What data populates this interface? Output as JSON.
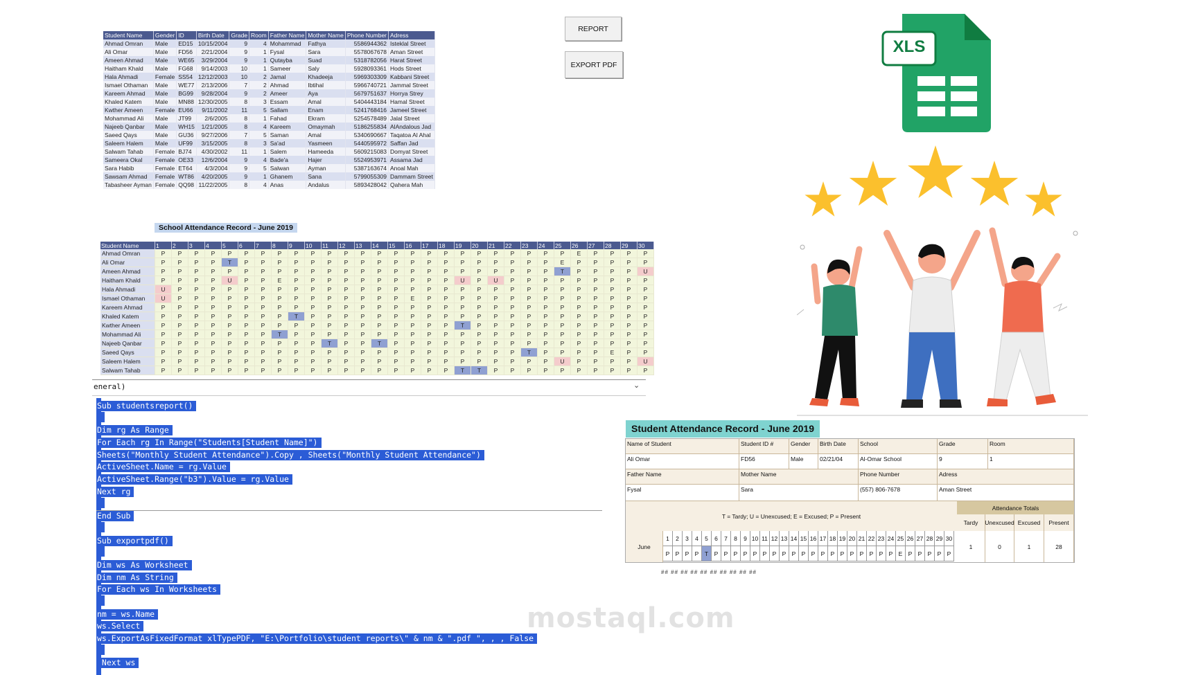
{
  "students": {
    "columns": [
      "Student Name",
      "Gender",
      "ID",
      "Birth Date",
      "Grade",
      "Room",
      "Father Name",
      "Mother Name",
      "Phone Number",
      "Adress"
    ],
    "rows": [
      [
        "Ahmad Omran",
        "Male",
        "ED15",
        "10/15/2004",
        "9",
        "4",
        "Mohammad",
        "Fathya",
        "5586944362",
        "Isteklal Street"
      ],
      [
        "Ali Omar",
        "Male",
        "FD56",
        "2/21/2004",
        "9",
        "1",
        "Fysal",
        "Sara",
        "5578067678",
        "Aman Street"
      ],
      [
        "Ameen Ahmad",
        "Male",
        "WE65",
        "3/29/2004",
        "9",
        "1",
        "Qutayba",
        "Suad",
        "5318782056",
        "Harat Street"
      ],
      [
        "Haitham Khald",
        "Male",
        "FG68",
        "9/14/2003",
        "10",
        "1",
        "Sameer",
        "Saly",
        "5928093361",
        "Hods Street"
      ],
      [
        "Hala Ahmadi",
        "Female",
        "SS54",
        "12/12/2003",
        "10",
        "2",
        "Jamal",
        "Khadeeja",
        "5969303309",
        "Kabbani Street"
      ],
      [
        "Ismael Othaman",
        "Male",
        "WE77",
        "2/13/2006",
        "7",
        "2",
        "Ahmad",
        "Ibtihal",
        "5966740721",
        "Jammal Street"
      ],
      [
        "Kareem Ahmad",
        "Male",
        "BG99",
        "9/28/2004",
        "9",
        "2",
        "Ameer",
        "Aya",
        "5679751637",
        "Horrya Strey"
      ],
      [
        "Khaled Katem",
        "Male",
        "MN88",
        "12/30/2005",
        "8",
        "3",
        "Essam",
        "Amal",
        "5404443184",
        "Hamal Street"
      ],
      [
        "Kwther Ameen",
        "Female",
        "EU66",
        "9/11/2002",
        "11",
        "5",
        "Sallam",
        "Enam",
        "5241768416",
        "Jameel Street"
      ],
      [
        "Mohammad Ali",
        "Male",
        "JT99",
        "2/6/2005",
        "8",
        "1",
        "Fahad",
        "Ekram",
        "5254578489",
        "Jalal Street"
      ],
      [
        "Najeeb Qanbar",
        "Male",
        "WH15",
        "1/21/2005",
        "8",
        "4",
        "Kareem",
        "Omaymah",
        "5186255834",
        "AlAndalous Jad"
      ],
      [
        "Saeed Qays",
        "Male",
        "GU36",
        "9/27/2006",
        "7",
        "5",
        "Saman",
        "Amal",
        "5340690667",
        "Taqatoa Al Ahal"
      ],
      [
        "Saleem Halem",
        "Male",
        "UF99",
        "3/15/2005",
        "8",
        "3",
        "Sa'ad",
        "Yasmeen",
        "5440595972",
        "Saffan Jad"
      ],
      [
        "Salwam Tahab",
        "Female",
        "BJ74",
        "4/30/2002",
        "11",
        "1",
        "Salem",
        "Hameeda",
        "5609215083",
        "Domyat Street"
      ],
      [
        "Sameera Okal",
        "Female",
        "OE33",
        "12/6/2004",
        "9",
        "4",
        "Bade'a",
        "Hajer",
        "5524953971",
        "Assama Jad"
      ],
      [
        "Sara Habib",
        "Female",
        "ET64",
        "4/3/2004",
        "9",
        "5",
        "Salwan",
        "Ayman",
        "5387163674",
        "Anoal Mah"
      ],
      [
        "Sawsam Ahmad",
        "Female",
        "WT86",
        "4/20/2005",
        "9",
        "1",
        "Ghanem",
        "Sana",
        "5799055309",
        "Dammam Street"
      ],
      [
        "Tabasheer Ayman",
        "Female",
        "QQ98",
        "11/22/2005",
        "8",
        "4",
        "Anas",
        "Andalus",
        "5893428042",
        "Qahera Mah"
      ]
    ]
  },
  "buttons": {
    "report": "REPORT",
    "export_pdf": "EXPORT PDF"
  },
  "xls_icon": {
    "label": "XLS",
    "color": "#21a366",
    "dark": "#107c41"
  },
  "attendance": {
    "title": "School Attendance Record - June 2019",
    "name_header": "Student Name",
    "days": [
      "1",
      "2",
      "3",
      "4",
      "5",
      "6",
      "7",
      "8",
      "9",
      "10",
      "11",
      "12",
      "13",
      "14",
      "15",
      "16",
      "17",
      "18",
      "19",
      "20",
      "21",
      "22",
      "23",
      "24",
      "25",
      "26",
      "27",
      "28",
      "29",
      "30"
    ],
    "rows": [
      {
        "name": "Ahmad Omran",
        "marks": "PPPPPPPPPPPPPPPPPPPPPPPPPEPPPP"
      },
      {
        "name": "Ali Omar",
        "marks": "PPPPTPPPPPPPPPPPPPPPPPPPEPPPPP"
      },
      {
        "name": "Ameen Ahmad",
        "marks": "PPPPPPPPPPPPPPPPPPPPPPPPTPPPPU"
      },
      {
        "name": "Haitham Khald",
        "marks": "PPPPUPPEPPPPPPPPPPUPUPPPPPPPPP"
      },
      {
        "name": "Hala Ahmadi",
        "marks": "UPPPPPPPPPPPPPPPPPPPPPPPPPPPPP"
      },
      {
        "name": "Ismael Othaman",
        "marks": "UPPPPPPPPPPPPPPEPPPPPPPPPPPPPP"
      },
      {
        "name": "Kareem Ahmad",
        "marks": "PPPPPPPPPPPPPPPPPPPPPPPPPPPPPP"
      },
      {
        "name": "Khaled Katem",
        "marks": "PPPPPPPPTPPPPPPPPPPPPPPPPPPPPP"
      },
      {
        "name": "Kwther Ameen",
        "marks": "PPPPPPPPPPPPPPPPPPTPPPPPPPPPPP"
      },
      {
        "name": "Mohammad Ali",
        "marks": "PPPPPPPTPPPPPPPPPPPPPPPPPPPPPP"
      },
      {
        "name": "Najeeb Qanbar",
        "marks": "PPPPPPPPPPTPPTPPPPPPPPPPPPPPPP"
      },
      {
        "name": "Saeed Qays",
        "marks": "PPPPPPPPPPPPPPPPPPPPPPTPPPPEPP"
      },
      {
        "name": "Saleem Halem",
        "marks": "PPPPPPPPPPPPPPPPPPPPPPPPUPPPPU"
      },
      {
        "name": "Salwam Tahab",
        "marks": "PPPPPPPPPPPPPPPPPPTTPPPPPPPPPP"
      }
    ]
  },
  "vba": {
    "general": "eneral)",
    "lines": [
      "Sub studentsreport()",
      "",
      "Dim rg As Range",
      "For Each rg In Range(\"Students[Student Name]\")",
      "Sheets(\"Monthly Student Attendance\").Copy , Sheets(\"Monthly Student Attendance\")",
      "ActiveSheet.Name = rg.Value",
      "ActiveSheet.Range(\"b3\").Value = rg.Value",
      "Next rg",
      "",
      "End Sub",
      "",
      "Sub exportpdf()",
      "",
      "Dim ws As Worksheet",
      "Dim nm As String",
      "For Each ws In Worksheets",
      "",
      "nm = ws.Name",
      "ws.Select",
      "ws.ExportAsFixedFormat xlTypePDF, \"E:\\Portfolio\\student reports\\\" & nm & \".pdf \", , , False",
      "",
      " Next ws"
    ]
  },
  "report_card": {
    "title": "Student Attendance Record - June 2019",
    "labels": {
      "name": "Name of Student",
      "id": "Student ID #",
      "gender": "Gender",
      "birth": "Birth Date",
      "school": "School",
      "grade": "Grade",
      "room": "Room",
      "father": "Father Name",
      "mother": "Mother Name",
      "phone": "Phone Number",
      "adress": "Adress"
    },
    "values": {
      "name": "Ali Omar",
      "id": "FD56",
      "gender": "Male",
      "birth": "02/21/04",
      "school": "Al-Omar School",
      "grade": "9",
      "room": "1",
      "father": "Fysal",
      "mother": "Sara",
      "phone": "(557) 806-7678",
      "adress": "Aman Street"
    },
    "legend": "T = Tardy; U = Unexcused; E = Excused; P = Present",
    "totals_header": "Attendance Totals",
    "totals_labels": [
      "Tardy",
      "Unexcused",
      "Excused",
      "Present"
    ],
    "totals_values": [
      "1",
      "0",
      "1",
      "28"
    ],
    "month": "June",
    "marks": "PPPPTPPPPPPPPPPPPPPPPPPPEPPPPP",
    "hashes": "## ## ## ## ## ## ## ## ## ##"
  },
  "watermark": "mostaql.com"
}
